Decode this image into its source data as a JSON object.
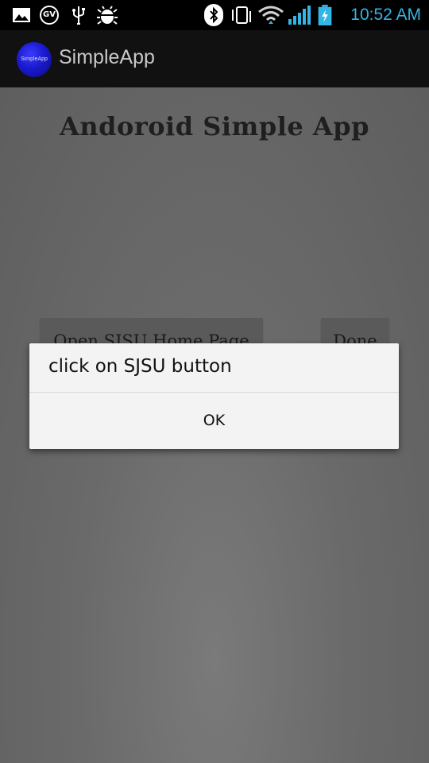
{
  "status_bar": {
    "time": "10:52 AM",
    "icons": [
      "image-icon",
      "google-voice-icon",
      "usb-icon",
      "debug-icon",
      "bluetooth-icon",
      "vibrate-icon",
      "wifi-icon",
      "signal-icon",
      "battery-charging-icon"
    ],
    "gv_label": "GV"
  },
  "action_bar": {
    "logo_text": "SimpleApp",
    "title": "SimpleApp"
  },
  "content": {
    "heading": "Andoroid Simple App",
    "sjsu_button": "Open SJSU Home Page",
    "done_button": "Done"
  },
  "dialog": {
    "message": "click on SJSU button",
    "ok_label": "OK"
  },
  "colors": {
    "status_text": "#ffffff",
    "time_color": "#33b5e5",
    "dim_background": "#6a6a6a",
    "dialog_background": "#f3f3f3"
  }
}
